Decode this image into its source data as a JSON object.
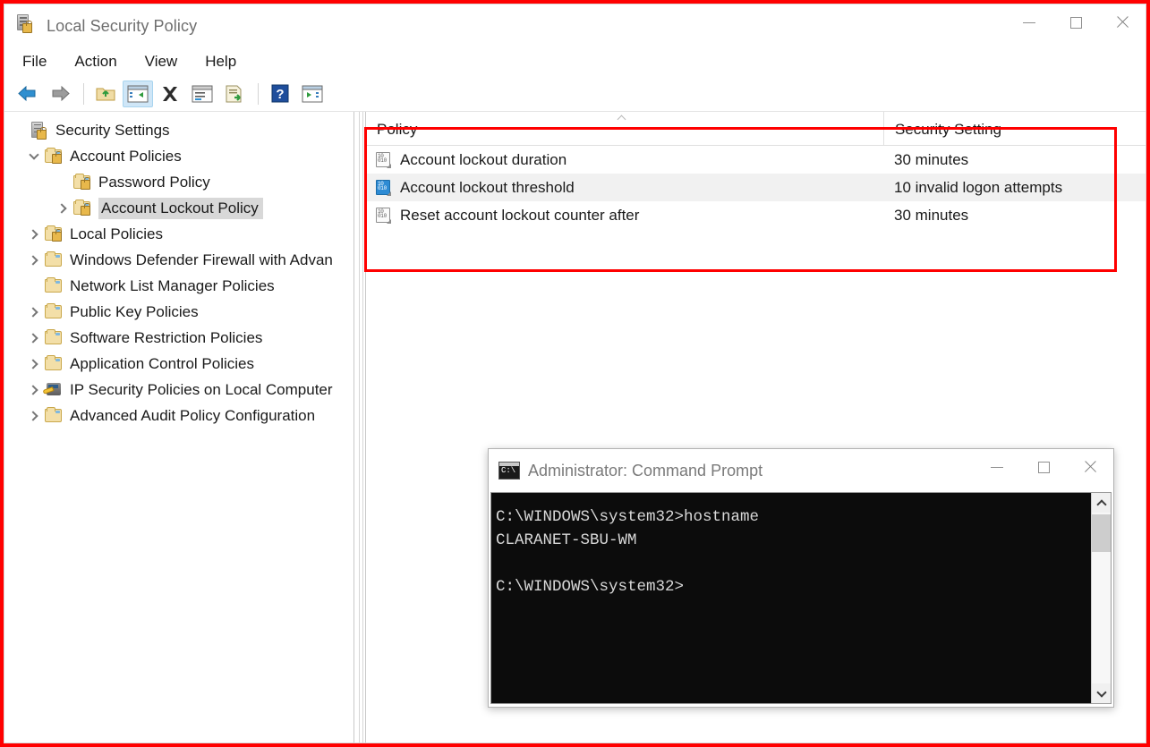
{
  "window": {
    "title": "Local Security Policy",
    "icon": "security-policy-icon",
    "controls": {
      "minimize": "minimize-icon",
      "maximize": "maximize-icon",
      "close": "close-icon"
    }
  },
  "menubar": {
    "items": [
      {
        "label": "File"
      },
      {
        "label": "Action"
      },
      {
        "label": "View"
      },
      {
        "label": "Help"
      }
    ]
  },
  "toolbar": {
    "buttons": [
      {
        "name": "back-icon"
      },
      {
        "name": "forward-icon"
      },
      {
        "name": "up-one-level-icon"
      },
      {
        "name": "show-hide-console-tree-icon"
      },
      {
        "name": "delete-icon"
      },
      {
        "name": "properties-icon"
      },
      {
        "name": "export-list-icon"
      },
      {
        "name": "help-icon"
      },
      {
        "name": "run-icon"
      }
    ]
  },
  "tree": {
    "items": [
      {
        "label": "Security Settings",
        "indent": 0,
        "expander": "none",
        "icon": "security-settings-icon",
        "selected": false
      },
      {
        "label": "Account Policies",
        "indent": 1,
        "expander": "expanded",
        "icon": "folder-lock-icon",
        "selected": false
      },
      {
        "label": "Password Policy",
        "indent": 2,
        "expander": "none",
        "icon": "folder-lock-icon",
        "selected": false
      },
      {
        "label": "Account Lockout Policy",
        "indent": 2,
        "expander": "collapsed",
        "icon": "folder-lock-icon",
        "selected": true
      },
      {
        "label": "Local Policies",
        "indent": 1,
        "expander": "collapsed",
        "icon": "folder-lock-icon",
        "selected": false
      },
      {
        "label": "Windows Defender Firewall with Advan",
        "indent": 1,
        "expander": "collapsed",
        "icon": "folder-icon",
        "selected": false
      },
      {
        "label": "Network List Manager Policies",
        "indent": 1,
        "expander": "none",
        "icon": "folder-icon",
        "selected": false
      },
      {
        "label": "Public Key Policies",
        "indent": 1,
        "expander": "collapsed",
        "icon": "folder-icon",
        "selected": false
      },
      {
        "label": "Software Restriction Policies",
        "indent": 1,
        "expander": "collapsed",
        "icon": "folder-icon",
        "selected": false
      },
      {
        "label": "Application Control Policies",
        "indent": 1,
        "expander": "collapsed",
        "icon": "folder-icon",
        "selected": false
      },
      {
        "label": "IP Security Policies on Local Computer",
        "indent": 1,
        "expander": "collapsed",
        "icon": "ip-security-icon",
        "selected": false
      },
      {
        "label": "Advanced Audit Policy Configuration",
        "indent": 1,
        "expander": "collapsed",
        "icon": "folder-icon",
        "selected": false
      }
    ]
  },
  "list": {
    "columns": [
      {
        "label": "Policy",
        "sorted": "ascending"
      },
      {
        "label": "Security Setting",
        "sorted": "none"
      }
    ],
    "rows": [
      {
        "policy": "Account lockout duration",
        "setting": "30 minutes",
        "selected": false,
        "icon": "policy-setting-icon"
      },
      {
        "policy": "Account lockout threshold",
        "setting": "10 invalid logon attempts",
        "selected": true,
        "icon": "policy-setting-icon-selected"
      },
      {
        "policy": "Reset account lockout counter after",
        "setting": "30 minutes",
        "selected": false,
        "icon": "policy-setting-icon"
      }
    ]
  },
  "cmd": {
    "title": "Administrator: Command Prompt",
    "icon": "command-prompt-icon",
    "controls": {
      "minimize": "minimize-icon",
      "maximize": "maximize-icon",
      "close": "close-icon"
    },
    "console_text": "C:\\WINDOWS\\system32>hostname\nCLARANET-SBU-WM\n\nC:\\WINDOWS\\system32>"
  },
  "annotations": {
    "highlight_color": "#ff0000",
    "border_color": "#ff0000"
  }
}
